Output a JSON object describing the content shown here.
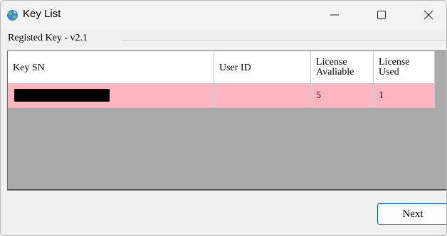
{
  "window": {
    "title": "Key List",
    "controls": {
      "minimize": "minimize",
      "maximize": "maximize",
      "close": "close"
    }
  },
  "group": {
    "label": "Registed Key - v2.1"
  },
  "table": {
    "columns": [
      {
        "label": "Key SN"
      },
      {
        "label": "User ID"
      },
      {
        "label_line1": "License",
        "label_line2": "Avaliable"
      },
      {
        "label_line1": "License",
        "label_line2": "Used"
      }
    ],
    "rows": [
      {
        "key_sn": "",
        "key_sn_redacted": true,
        "user_id": "",
        "license_available": "5",
        "license_used": "1"
      }
    ],
    "colors": {
      "selected_row": "#ffb6c1",
      "empty_area": "#ababab"
    }
  },
  "buttons": {
    "next": "Next"
  }
}
